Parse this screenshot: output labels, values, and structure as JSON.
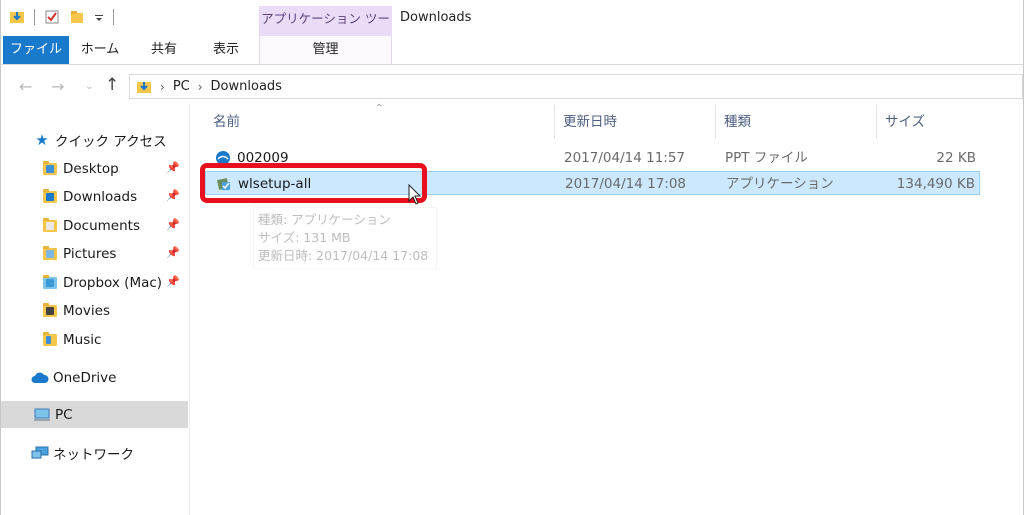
{
  "window": {
    "title": "Downloads",
    "tool_tab_header": "アプリケーション ツール"
  },
  "ribbon": {
    "tabs": [
      {
        "label": "ファイル"
      },
      {
        "label": "ホーム"
      },
      {
        "label": "共有"
      },
      {
        "label": "表示"
      },
      {
        "label": "管理"
      }
    ]
  },
  "address": {
    "crumbs": [
      "PC",
      "Downloads"
    ]
  },
  "sidebar": {
    "quick_access": "クイック アクセス",
    "items": [
      {
        "label": "Desktop"
      },
      {
        "label": "Downloads"
      },
      {
        "label": "Documents"
      },
      {
        "label": "Pictures"
      },
      {
        "label": "Dropbox (Mac)"
      },
      {
        "label": "Movies"
      },
      {
        "label": "Music"
      }
    ],
    "onedrive": "OneDrive",
    "pc": "PC",
    "network": "ネットワーク"
  },
  "columns": {
    "name": "名前",
    "date": "更新日時",
    "type": "種類",
    "size": "サイズ"
  },
  "files": [
    {
      "name": "002009",
      "date": "2017/04/14 11:57",
      "type": "PPT ファイル",
      "size": "22 KB"
    },
    {
      "name": "wlsetup-all",
      "date": "2017/04/14 17:08",
      "type": "アプリケーション",
      "size": "134,490 KB"
    }
  ],
  "tooltip": {
    "line1": "種類: アプリケーション",
    "line2": "サイズ: 131 MB",
    "line3": "更新日時: 2017/04/14 17:08"
  },
  "colors": {
    "file_tab": "#1979ca",
    "selection": "#cce8ff",
    "highlight": "#e8101e",
    "tool_tab": "#eadcf6"
  }
}
